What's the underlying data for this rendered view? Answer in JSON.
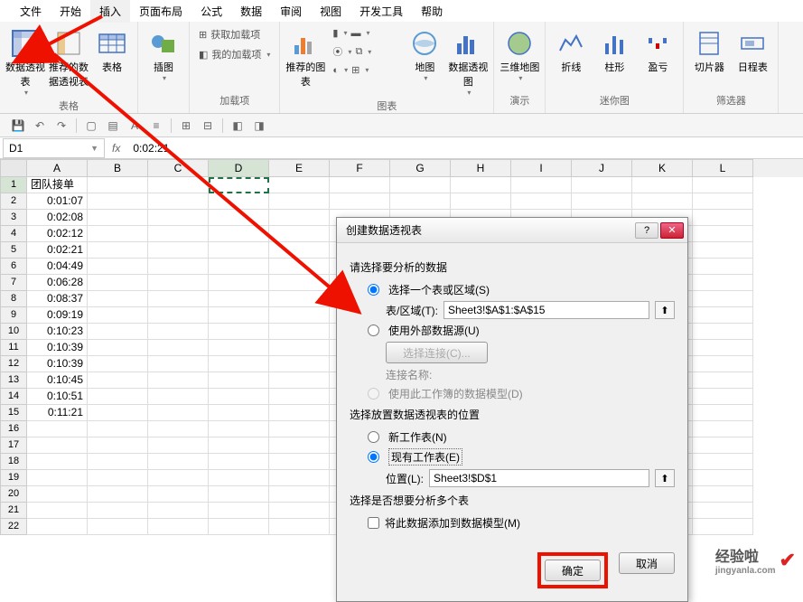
{
  "menubar": [
    "文件",
    "开始",
    "插入",
    "页面布局",
    "公式",
    "数据",
    "审阅",
    "视图",
    "开发工具",
    "帮助"
  ],
  "active_menu": 2,
  "ribbon": {
    "groups": [
      {
        "label": "表格",
        "items": [
          {
            "label": "数据透视表"
          },
          {
            "label": "推荐的数据透视表"
          },
          {
            "label": "表格"
          }
        ]
      },
      {
        "label": "",
        "items": [
          {
            "label": "插图"
          }
        ]
      },
      {
        "label": "加载项",
        "items": [
          {
            "label": "获取加载项"
          },
          {
            "label": "我的加载项"
          }
        ]
      },
      {
        "label": "图表",
        "items": [
          {
            "label": "推荐的图表"
          },
          {
            "label": "地图"
          },
          {
            "label": "数据透视图"
          }
        ]
      },
      {
        "label": "演示",
        "items": [
          {
            "label": "三维地图"
          }
        ]
      },
      {
        "label": "迷你图",
        "items": [
          {
            "label": "折线"
          },
          {
            "label": "柱形"
          },
          {
            "label": "盈亏"
          }
        ]
      },
      {
        "label": "筛选器",
        "items": [
          {
            "label": "切片器"
          },
          {
            "label": "日程表"
          }
        ]
      }
    ]
  },
  "name_box": "D1",
  "formula": "0:02:21",
  "columns": [
    "A",
    "B",
    "C",
    "D",
    "E",
    "F",
    "G",
    "H",
    "I",
    "J",
    "K",
    "L"
  ],
  "rows": [
    {
      "n": 1,
      "A": "团队接单"
    },
    {
      "n": 2,
      "A": "0:01:07"
    },
    {
      "n": 3,
      "A": "0:02:08"
    },
    {
      "n": 4,
      "A": "0:02:12"
    },
    {
      "n": 5,
      "A": "0:02:21"
    },
    {
      "n": 6,
      "A": "0:04:49"
    },
    {
      "n": 7,
      "A": "0:06:28"
    },
    {
      "n": 8,
      "A": "0:08:37"
    },
    {
      "n": 9,
      "A": "0:09:19"
    },
    {
      "n": 10,
      "A": "0:10:23"
    },
    {
      "n": 11,
      "A": "0:10:39"
    },
    {
      "n": 12,
      "A": "0:10:39"
    },
    {
      "n": 13,
      "A": "0:10:45"
    },
    {
      "n": 14,
      "A": "0:10:51"
    },
    {
      "n": 15,
      "A": "0:11:21"
    },
    {
      "n": 16,
      "A": ""
    },
    {
      "n": 17,
      "A": ""
    },
    {
      "n": 18,
      "A": ""
    },
    {
      "n": 19,
      "A": ""
    },
    {
      "n": 20,
      "A": ""
    },
    {
      "n": 21,
      "A": ""
    },
    {
      "n": 22,
      "A": ""
    }
  ],
  "dialog": {
    "title": "创建数据透视表",
    "sec1": "请选择要分析的数据",
    "opt_table": "选择一个表或区域(S)",
    "label_range": "表/区域(T):",
    "range_value": "Sheet3!$A$1:$A$15",
    "opt_ext": "使用外部数据源(U)",
    "btn_conn": "选择连接(C)...",
    "label_conn": "连接名称:",
    "opt_model": "使用此工作簿的数据模型(D)",
    "sec2": "选择放置数据透视表的位置",
    "opt_new": "新工作表(N)",
    "opt_exist": "现有工作表(E)",
    "label_loc": "位置(L):",
    "loc_value": "Sheet3!$D$1",
    "sec3": "选择是否想要分析多个表",
    "chk_multi": "将此数据添加到数据模型(M)",
    "ok": "确定",
    "cancel": "取消"
  },
  "watermark": {
    "brand": "经验啦",
    "url": "jingyanla.com"
  }
}
